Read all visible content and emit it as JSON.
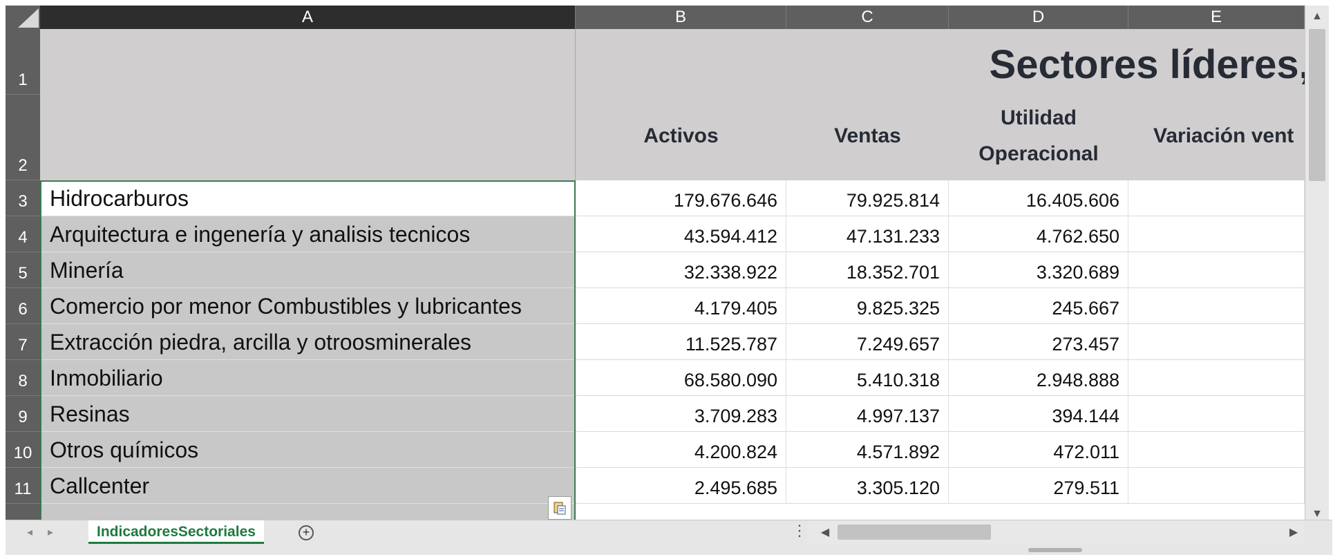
{
  "columns": [
    "A",
    "B",
    "C",
    "D",
    "E"
  ],
  "rows": [
    "1",
    "2",
    "3",
    "4",
    "5",
    "6",
    "7",
    "8",
    "9",
    "10",
    "11"
  ],
  "header": {
    "title": "Sectores líderes, i",
    "col_b": "Activos",
    "col_c": "Ventas",
    "col_d_line1": "Utilidad",
    "col_d_line2": "Operacional",
    "col_e": "Variación vent"
  },
  "table": [
    {
      "sector": "Hidrocarburos",
      "activos": "179.676.646",
      "ventas": "79.925.814",
      "utilidad": "16.405.606"
    },
    {
      "sector": "Arquitectura e ingenería y analisis tecnicos",
      "activos": "43.594.412",
      "ventas": "47.131.233",
      "utilidad": "4.762.650"
    },
    {
      "sector": "Minería",
      "activos": "32.338.922",
      "ventas": "18.352.701",
      "utilidad": "3.320.689"
    },
    {
      "sector": "Comercio por menor Combustibles y lubricantes",
      "activos": "4.179.405",
      "ventas": "9.825.325",
      "utilidad": "245.667"
    },
    {
      "sector": "Extracción piedra, arcilla y otroosminerales",
      "activos": "11.525.787",
      "ventas": "7.249.657",
      "utilidad": "273.457"
    },
    {
      "sector": "Inmobiliario",
      "activos": "68.580.090",
      "ventas": "5.410.318",
      "utilidad": "2.948.888"
    },
    {
      "sector": "Resinas",
      "activos": "3.709.283",
      "ventas": "4.997.137",
      "utilidad": "394.144"
    },
    {
      "sector": "Otros químicos",
      "activos": "4.200.824",
      "ventas": "4.571.892",
      "utilidad": "472.011"
    },
    {
      "sector": "Callcenter",
      "activos": "2.495.685",
      "ventas": "3.305.120",
      "utilidad": "279.511"
    }
  ],
  "sheet_tab": "IndicadoresSectoriales",
  "icons": {
    "select_all": "select-all-triangle",
    "paste_options": "paste-options-icon",
    "add_sheet": "plus-circle-icon",
    "scroll_up": "arrow-up-icon",
    "scroll_down": "arrow-down-icon",
    "scroll_left": "arrow-left-icon",
    "scroll_right": "arrow-right-icon"
  },
  "colors": {
    "selection_border": "#3b7a4f",
    "tab_text": "#1e7a3e",
    "header_fill": "#d0cecf"
  }
}
